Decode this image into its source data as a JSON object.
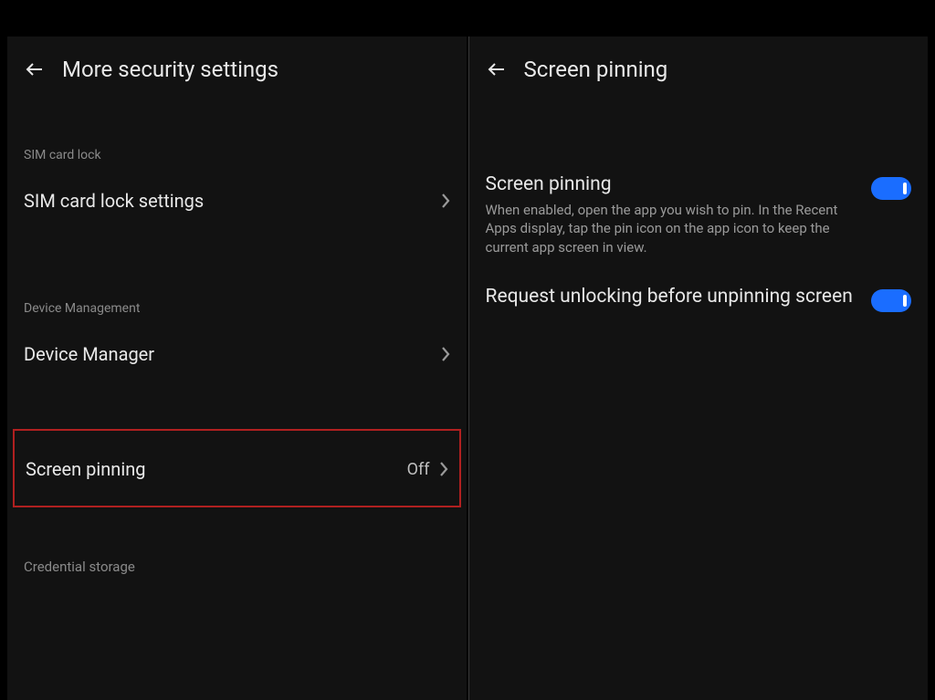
{
  "left": {
    "title": "More security settings",
    "section1": "SIM card lock",
    "row1": "SIM card lock settings",
    "section2": "Device Management",
    "row2": "Device Manager",
    "row3": "Screen pinning",
    "row3_value": "Off",
    "section3": "Credential storage"
  },
  "right": {
    "title": "Screen pinning",
    "setting1_title": "Screen pinning",
    "setting1_desc": "When enabled, open the app you wish to pin. In the Recent Apps display, tap the pin icon on the app icon to keep the current app screen in view.",
    "setting2_title": "Request unlocking before unpinning screen"
  }
}
